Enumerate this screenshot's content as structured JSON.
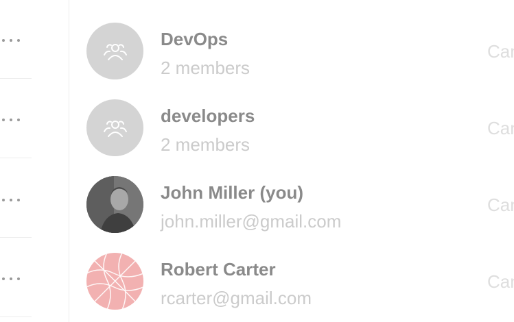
{
  "members": [
    {
      "name": "DevOps",
      "subtitle": "2 members",
      "role": "Can",
      "avatar": "group-icon"
    },
    {
      "name": "developers",
      "subtitle": "2 members",
      "role": "Can",
      "avatar": "group-icon"
    },
    {
      "name": "John Miller (you)",
      "subtitle": "john.miller@gmail.com",
      "role": "Can",
      "avatar": "user-photo"
    },
    {
      "name": "Robert Carter",
      "subtitle": "rcarter@gmail.com",
      "role": "Can",
      "avatar": "pattern-avatar"
    }
  ],
  "left_menu": {
    "icon": "more-dots-icon",
    "count": 4
  },
  "colors": {
    "group_avatar_bg": "#d4d4d4",
    "pattern_avatar_bg": "#f2b1b1",
    "name_text": "#8a8a8a",
    "subtitle_text": "#cbcbcb"
  }
}
